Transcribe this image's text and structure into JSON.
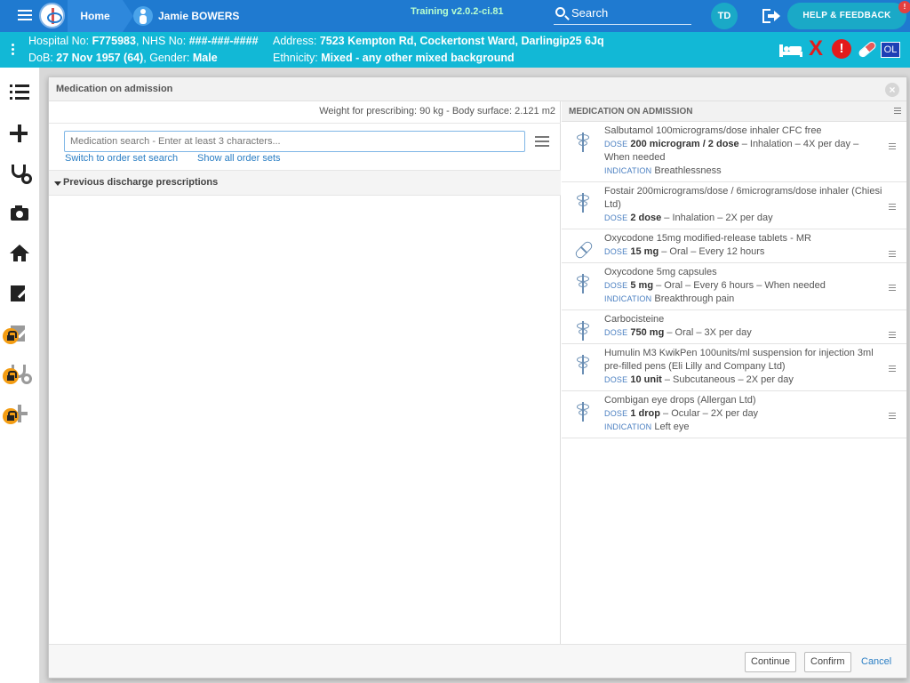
{
  "topbar": {
    "home_label": "Home",
    "patient_name": "Jamie BOWERS",
    "training_label": "Training v2.0.2-ci.81",
    "search_label": "Search",
    "user_initials": "TD",
    "help_label": "HELP & FEEDBACK",
    "help_badge": "!"
  },
  "banner": {
    "hospital_prefix": "Hospital No:",
    "hospital_no": "F775983",
    "nhs_prefix": ", NHS No:",
    "nhs_no": "###-###-####",
    "address_prefix": "Address:",
    "address": "7523 Kempton Rd, Cockertonst Ward, Darlingip25 6Jq",
    "dob_prefix": "DoB:",
    "dob": "27 Nov 1957 (64)",
    "gender_prefix": ", Gender:",
    "gender": "Male",
    "ethnicity_prefix": "Ethnicity:",
    "ethnicity": "Mixed - any other mixed background",
    "alert_icon": "!",
    "x_icon": "X",
    "ol_badge": "OL"
  },
  "modal": {
    "title": "Medication on admission",
    "close_icon": "×",
    "weight_line": "Weight for prescribing: 90 kg - Body surface: 2.121 m2",
    "search_placeholder": "Medication search - Enter at least 3 characters...",
    "link_order_set": "Switch to order set search",
    "link_show_all": "Show all order sets",
    "previous_section": "Previous discharge prescriptions",
    "right_title": "MEDICATION ON ADMISSION",
    "dose_key": "DOSE",
    "indication_key": "INDICATION",
    "continue_label": "Continue",
    "confirm_label": "Confirm",
    "cancel_label": "Cancel"
  },
  "medications": [
    {
      "name": "Salbutamol 100micrograms/dose inhaler CFC free",
      "dose": "200 microgram / 2 dose",
      "details": " – Inhalation – 4X per day – When needed",
      "indication": "Breathlessness",
      "icon": "caduceus-icon"
    },
    {
      "name": "Fostair 200micrograms/dose / 6micrograms/dose inhaler (Chiesi Ltd)",
      "dose": "2 dose",
      "details": " – Inhalation – 2X per day",
      "indication": "",
      "icon": "caduceus-icon"
    },
    {
      "name": "Oxycodone 15mg modified-release tablets - MR",
      "dose": "15 mg",
      "details": " – Oral – Every 12 hours",
      "indication": "",
      "icon": "capsule-icon"
    },
    {
      "name": "Oxycodone 5mg capsules",
      "dose": "5 mg",
      "details": " – Oral – Every 6 hours – When needed",
      "indication": "Breakthrough pain",
      "icon": "caduceus-icon"
    },
    {
      "name": "Carbocisteine",
      "dose": "750 mg",
      "details": " – Oral – 3X per day",
      "indication": "",
      "icon": "caduceus-icon"
    },
    {
      "name": "Humulin M3 KwikPen 100units/ml suspension for injection 3ml pre-filled pens (Eli Lilly and Company Ltd)",
      "dose": "10 unit",
      "details": " – Subcutaneous – 2X per day",
      "indication": "",
      "icon": "caduceus-icon"
    },
    {
      "name": "Combigan eye drops (Allergan Ltd)",
      "dose": "1 drop",
      "details": " – Ocular – 2X per day",
      "indication": "Left eye",
      "icon": "caduceus-icon"
    }
  ],
  "colors": {
    "topbar": "#1f7ad0",
    "banner": "#12b8d6",
    "accent_link": "#2a7ec4",
    "alert_red": "#e31b1b",
    "lock_orange": "#f39c12"
  }
}
